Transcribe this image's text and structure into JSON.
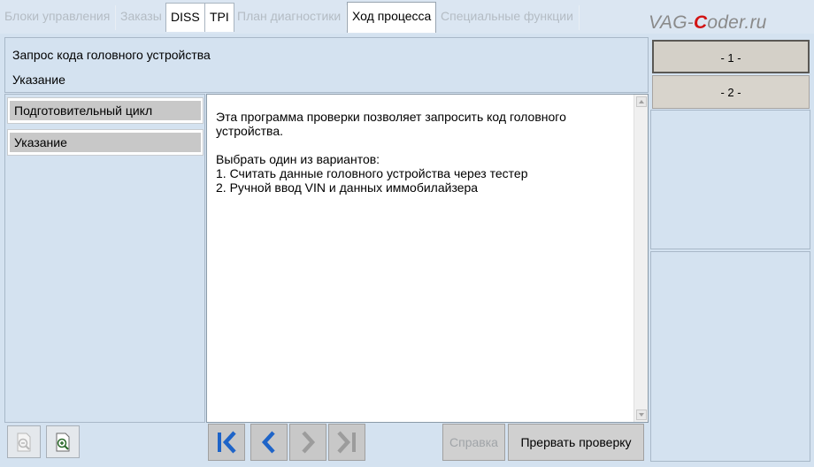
{
  "tabs": [
    {
      "label": "Блоки управления",
      "state": "disabled"
    },
    {
      "label": "Заказы",
      "state": "disabled"
    },
    {
      "label": "DISS",
      "state": "enabled"
    },
    {
      "label": "TPI",
      "state": "enabled"
    },
    {
      "label": "План диагностики",
      "state": "disabled"
    },
    {
      "label": "Ход процесса",
      "state": "active"
    },
    {
      "label": "Специальные функции",
      "state": "disabled"
    }
  ],
  "logo": {
    "prefix": "VAG-",
    "highlight": "C",
    "suffix": "oder.ru",
    "highlight_color": "#d21414"
  },
  "header": {
    "title": "Запрос кода головного устройства",
    "subtitle": "Указание"
  },
  "steps": [
    {
      "label": "- 1 -",
      "active": true
    },
    {
      "label": "- 2 -",
      "active": false
    }
  ],
  "left_list": [
    {
      "label": "Подготовительный цикл"
    },
    {
      "label": "Указание"
    }
  ],
  "content": {
    "text": "Эта программа проверки позволяет запросить код головного\nустройства.\n\nВыбрать один из вариантов:\n1. Считать данные головного устройства через тестер\n2. Ручной ввод VIN и данных иммобилайзера"
  },
  "toolbar": {
    "zoom_out_icon": "zoom-out-document-icon",
    "zoom_in_icon": "zoom-in-document-icon",
    "nav_icons": [
      "skip-to-start-icon",
      "previous-icon",
      "next-icon",
      "skip-to-end-icon"
    ],
    "help_label": "Справка",
    "abort_label": "Прервать проверку"
  },
  "colors": {
    "nav_active": "#1e64c8",
    "nav_disabled": "#9c9c9c"
  }
}
